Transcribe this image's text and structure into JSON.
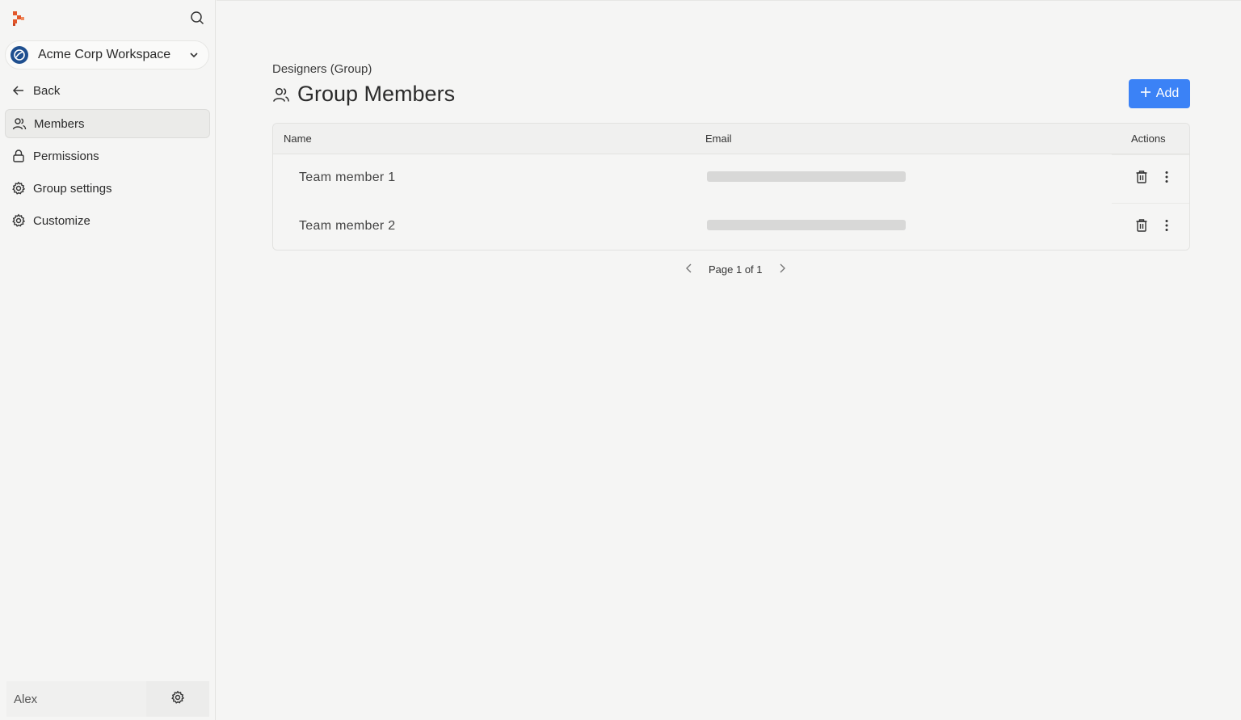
{
  "sidebar": {
    "workspace": {
      "name": "Acme Corp Workspace"
    },
    "back_label": "Back",
    "items": [
      {
        "label": "Members",
        "icon": "users-icon",
        "active": true
      },
      {
        "label": "Permissions",
        "icon": "lock-icon",
        "active": false
      },
      {
        "label": "Group settings",
        "icon": "gear-icon",
        "active": false
      },
      {
        "label": "Customize",
        "icon": "gear-icon",
        "active": false
      }
    ],
    "user": {
      "name": "Alex"
    }
  },
  "main": {
    "breadcrumb": "Designers (Group)",
    "title": "Group Members",
    "add_label": "Add",
    "table": {
      "columns": [
        "Name",
        "Email",
        "Actions"
      ],
      "rows": [
        {
          "name": "Team member 1"
        },
        {
          "name": "Team member 2"
        }
      ]
    },
    "pager": {
      "label": "Page 1 of 1"
    }
  },
  "colors": {
    "accent": "#3b82f6",
    "brand": "#e2572b",
    "workspace_avatar": "#1f4f8f"
  }
}
